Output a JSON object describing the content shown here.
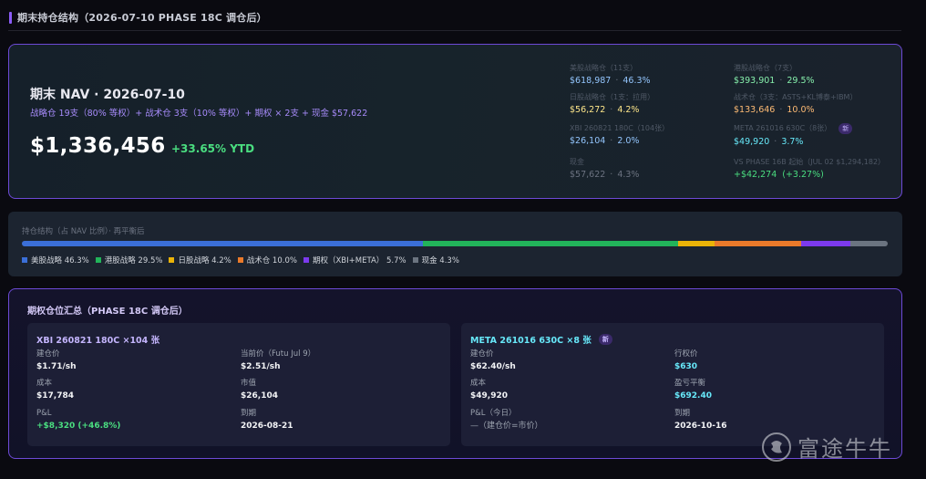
{
  "section_title": "期末持仓结构（2026-07-10 PHASE 18C 调仓后）",
  "nav": {
    "title": "期末 NAV · 2026-07-10",
    "subtitle": "战略仓 19支（80% 等权）+ 战术仓 3支（10% 等权）+ 期权 × 2支 + 现金 $57,622",
    "value": "$1,336,456",
    "ytd": "+33.65% YTD",
    "stats_left": [
      {
        "label": "美股战略仓（11支）",
        "amount": "$618,987",
        "pct": "46.3%",
        "color": "blue"
      },
      {
        "label": "日股战略仓（1支：拉用）",
        "amount": "$56,272",
        "pct": "4.2%",
        "color": "yellow"
      },
      {
        "label": "XBI 260821 180C（104张）",
        "amount": "$26,104",
        "pct": "2.0%",
        "color": "blue"
      },
      {
        "label": "现金",
        "amount": "$57,622",
        "pct": "4.3%",
        "color": "gray"
      }
    ],
    "stats_right": [
      {
        "label": "港股战略仓（7支）",
        "amount": "$393,901",
        "pct": "29.5%",
        "color": "green"
      },
      {
        "label": "战术仓（3支：ASTS+KL博泰+IBM）",
        "amount": "$133,646",
        "pct": "10.0%",
        "color": "orange"
      },
      {
        "label": "META 261016 630C（8张）",
        "badge": "新",
        "amount": "$49,920",
        "pct": "3.7%",
        "color": "cyan"
      },
      {
        "label": "VS PHASE 16B 起始（JUL 02 $1,294,182）",
        "amount": "+$42,274",
        "pct": "(+3.27%)",
        "color": "bright-green"
      }
    ]
  },
  "allocation": {
    "title": "持仓结构（占 NAV 比例）· 再平衡后",
    "segments": [
      {
        "label": "美股战略",
        "pct_text": "46.3%",
        "pct": 46.3,
        "color": "#3b6fd8"
      },
      {
        "label": "港股战略",
        "pct_text": "29.5%",
        "pct": 29.5,
        "color": "#22b45a"
      },
      {
        "label": "日股战略",
        "pct_text": "4.2%",
        "pct": 4.2,
        "color": "#eab308"
      },
      {
        "label": "战术仓",
        "pct_text": "10.0%",
        "pct": 10.0,
        "color": "#ea7a2a"
      },
      {
        "label": "期权（XBI+META）",
        "pct_text": "5.7%",
        "pct": 5.7,
        "color": "#7c3aed"
      },
      {
        "label": "现金",
        "pct_text": "4.3%",
        "pct": 4.3,
        "color": "#6b7480"
      }
    ]
  },
  "options": {
    "title": "期权仓位汇总（PHASE 18C 调仓后）",
    "positions": [
      {
        "name": "XBI 260821 180C ×104 张",
        "name_color": "#c4b5fd",
        "badge": "",
        "fields": [
          {
            "label": "建仓价",
            "value": "$1.71/sh",
            "style": "plain"
          },
          {
            "label": "当前价（Futu Jul 9）",
            "value": "$2.51/sh",
            "style": "plain"
          },
          {
            "label": "成本",
            "value": "$17,784",
            "style": "plain"
          },
          {
            "label": "市值",
            "value": "$26,104",
            "style": "plain"
          },
          {
            "label": "P&L",
            "value": "+$8,320 (+46.8%)",
            "style": "green"
          },
          {
            "label": "到期",
            "value": "2026-08-21",
            "style": "plain"
          }
        ]
      },
      {
        "name": "META 261016 630C ×8 张",
        "name_color": "#67e8f9",
        "badge": "新",
        "fields": [
          {
            "label": "建仓价",
            "value": "$62.40/sh",
            "style": "plain"
          },
          {
            "label": "行权价",
            "value": "$630",
            "style": "cyan"
          },
          {
            "label": "成本",
            "value": "$49,920",
            "style": "plain"
          },
          {
            "label": "盈亏平衡",
            "value": "$692.40",
            "style": "cyan"
          },
          {
            "label": "P&L（今日）",
            "value": "—（建仓价=市价）",
            "style": "muted"
          },
          {
            "label": "到期",
            "value": "2026-10-16",
            "style": "plain"
          }
        ]
      }
    ]
  },
  "watermark": {
    "text": "富途牛牛",
    "icon": "futu-logo-icon"
  }
}
